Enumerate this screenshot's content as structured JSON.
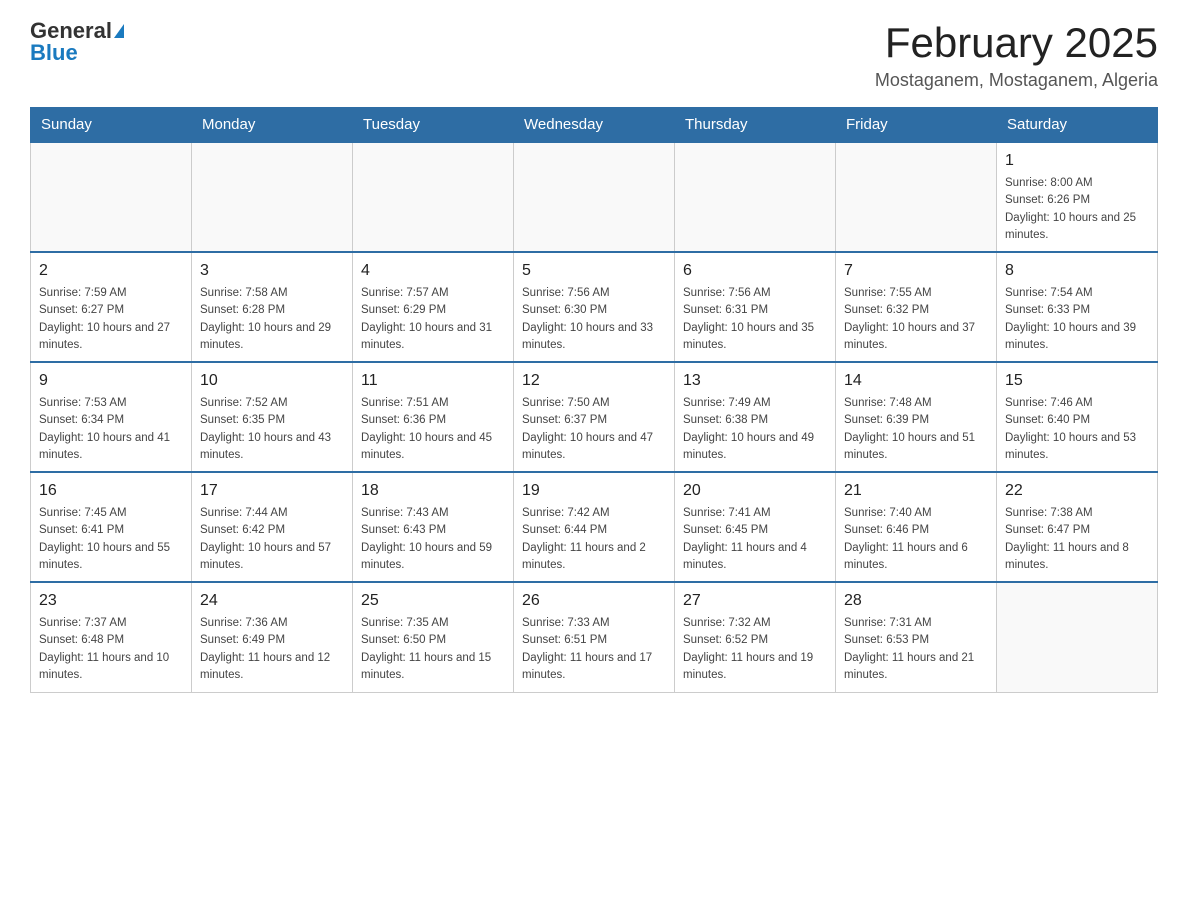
{
  "header": {
    "logo_general": "General",
    "logo_blue": "Blue",
    "month_title": "February 2025",
    "location": "Mostaganem, Mostaganem, Algeria"
  },
  "weekdays": [
    "Sunday",
    "Monday",
    "Tuesday",
    "Wednesday",
    "Thursday",
    "Friday",
    "Saturday"
  ],
  "weeks": [
    [
      {
        "day": "",
        "info": ""
      },
      {
        "day": "",
        "info": ""
      },
      {
        "day": "",
        "info": ""
      },
      {
        "day": "",
        "info": ""
      },
      {
        "day": "",
        "info": ""
      },
      {
        "day": "",
        "info": ""
      },
      {
        "day": "1",
        "info": "Sunrise: 8:00 AM\nSunset: 6:26 PM\nDaylight: 10 hours and 25 minutes."
      }
    ],
    [
      {
        "day": "2",
        "info": "Sunrise: 7:59 AM\nSunset: 6:27 PM\nDaylight: 10 hours and 27 minutes."
      },
      {
        "day": "3",
        "info": "Sunrise: 7:58 AM\nSunset: 6:28 PM\nDaylight: 10 hours and 29 minutes."
      },
      {
        "day": "4",
        "info": "Sunrise: 7:57 AM\nSunset: 6:29 PM\nDaylight: 10 hours and 31 minutes."
      },
      {
        "day": "5",
        "info": "Sunrise: 7:56 AM\nSunset: 6:30 PM\nDaylight: 10 hours and 33 minutes."
      },
      {
        "day": "6",
        "info": "Sunrise: 7:56 AM\nSunset: 6:31 PM\nDaylight: 10 hours and 35 minutes."
      },
      {
        "day": "7",
        "info": "Sunrise: 7:55 AM\nSunset: 6:32 PM\nDaylight: 10 hours and 37 minutes."
      },
      {
        "day": "8",
        "info": "Sunrise: 7:54 AM\nSunset: 6:33 PM\nDaylight: 10 hours and 39 minutes."
      }
    ],
    [
      {
        "day": "9",
        "info": "Sunrise: 7:53 AM\nSunset: 6:34 PM\nDaylight: 10 hours and 41 minutes."
      },
      {
        "day": "10",
        "info": "Sunrise: 7:52 AM\nSunset: 6:35 PM\nDaylight: 10 hours and 43 minutes."
      },
      {
        "day": "11",
        "info": "Sunrise: 7:51 AM\nSunset: 6:36 PM\nDaylight: 10 hours and 45 minutes."
      },
      {
        "day": "12",
        "info": "Sunrise: 7:50 AM\nSunset: 6:37 PM\nDaylight: 10 hours and 47 minutes."
      },
      {
        "day": "13",
        "info": "Sunrise: 7:49 AM\nSunset: 6:38 PM\nDaylight: 10 hours and 49 minutes."
      },
      {
        "day": "14",
        "info": "Sunrise: 7:48 AM\nSunset: 6:39 PM\nDaylight: 10 hours and 51 minutes."
      },
      {
        "day": "15",
        "info": "Sunrise: 7:46 AM\nSunset: 6:40 PM\nDaylight: 10 hours and 53 minutes."
      }
    ],
    [
      {
        "day": "16",
        "info": "Sunrise: 7:45 AM\nSunset: 6:41 PM\nDaylight: 10 hours and 55 minutes."
      },
      {
        "day": "17",
        "info": "Sunrise: 7:44 AM\nSunset: 6:42 PM\nDaylight: 10 hours and 57 minutes."
      },
      {
        "day": "18",
        "info": "Sunrise: 7:43 AM\nSunset: 6:43 PM\nDaylight: 10 hours and 59 minutes."
      },
      {
        "day": "19",
        "info": "Sunrise: 7:42 AM\nSunset: 6:44 PM\nDaylight: 11 hours and 2 minutes."
      },
      {
        "day": "20",
        "info": "Sunrise: 7:41 AM\nSunset: 6:45 PM\nDaylight: 11 hours and 4 minutes."
      },
      {
        "day": "21",
        "info": "Sunrise: 7:40 AM\nSunset: 6:46 PM\nDaylight: 11 hours and 6 minutes."
      },
      {
        "day": "22",
        "info": "Sunrise: 7:38 AM\nSunset: 6:47 PM\nDaylight: 11 hours and 8 minutes."
      }
    ],
    [
      {
        "day": "23",
        "info": "Sunrise: 7:37 AM\nSunset: 6:48 PM\nDaylight: 11 hours and 10 minutes."
      },
      {
        "day": "24",
        "info": "Sunrise: 7:36 AM\nSunset: 6:49 PM\nDaylight: 11 hours and 12 minutes."
      },
      {
        "day": "25",
        "info": "Sunrise: 7:35 AM\nSunset: 6:50 PM\nDaylight: 11 hours and 15 minutes."
      },
      {
        "day": "26",
        "info": "Sunrise: 7:33 AM\nSunset: 6:51 PM\nDaylight: 11 hours and 17 minutes."
      },
      {
        "day": "27",
        "info": "Sunrise: 7:32 AM\nSunset: 6:52 PM\nDaylight: 11 hours and 19 minutes."
      },
      {
        "day": "28",
        "info": "Sunrise: 7:31 AM\nSunset: 6:53 PM\nDaylight: 11 hours and 21 minutes."
      },
      {
        "day": "",
        "info": ""
      }
    ]
  ]
}
